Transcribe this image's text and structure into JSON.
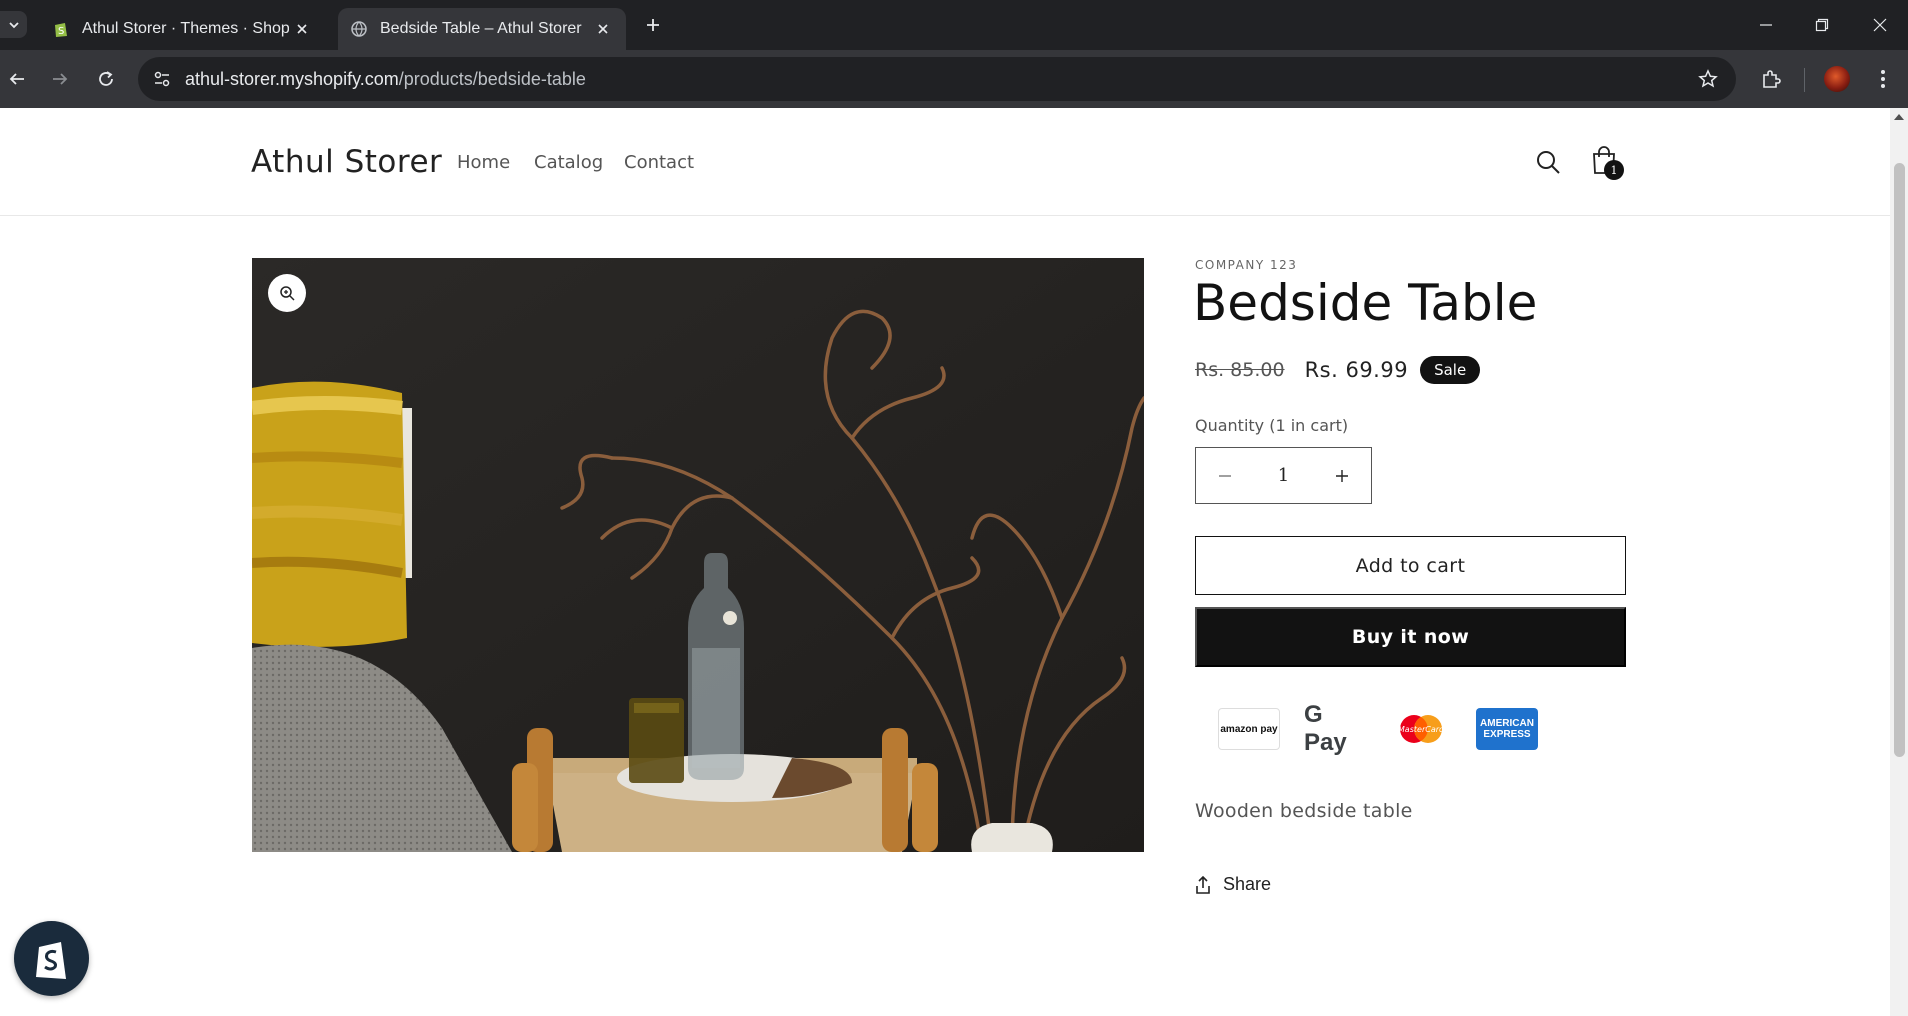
{
  "browser": {
    "tabs": [
      {
        "title": "Athul Storer · Themes · Shopify",
        "active": false
      },
      {
        "title": "Bedside Table – Athul Storer",
        "active": true
      }
    ],
    "url_host": "athul-storer.myshopify.com",
    "url_path": "/products/bedside-table"
  },
  "store": {
    "name": "Athul Storer",
    "nav": [
      "Home",
      "Catalog",
      "Contact"
    ],
    "cart_count": "1"
  },
  "product": {
    "vendor": "COMPANY 123",
    "title": "Bedside Table",
    "compare_price": "Rs. 85.00",
    "sale_price": "Rs. 69.99",
    "badge": "Sale",
    "quantity_label": "Quantity (1 in cart)",
    "quantity": "1",
    "add_to_cart": "Add to cart",
    "buy_now": "Buy it now",
    "payment_methods": {
      "amazon": "amazon pay",
      "gpay": "G Pay",
      "mastercard": "MasterCard",
      "amex_line1": "AMERICAN",
      "amex_line2": "EXPRESS"
    },
    "description": "Wooden bedside table",
    "share": "Share"
  },
  "colors": {
    "accent_dark": "#121212",
    "chrome_bg": "#202124",
    "amex_blue": "#1f72cd"
  }
}
